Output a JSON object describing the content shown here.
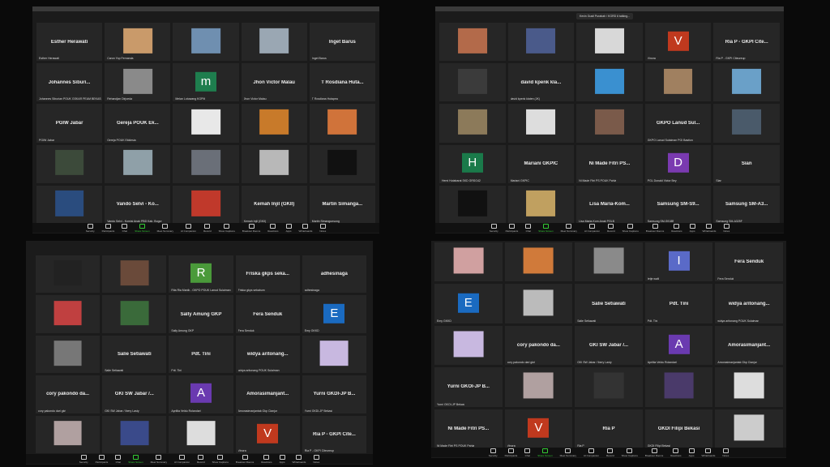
{
  "windows": [
    {
      "id": "top-left",
      "tiles": [
        {
          "type": "name",
          "label": "Esther Herawati",
          "name": "Esther Herawati"
        },
        {
          "type": "photo",
          "label": "",
          "name": "Caron Yop Fernanda",
          "color": "#c99a6a"
        },
        {
          "type": "photo",
          "label": "",
          "name": "",
          "color": "#6f8fb0"
        },
        {
          "type": "photo",
          "label": "",
          "name": "",
          "color": "#9aa7b3"
        },
        {
          "type": "name",
          "label": "Inget Barus",
          "name": "Inget Barus"
        },
        {
          "type": "name",
          "label": "Johannes Siburi...",
          "name": "Johannes Siburian POUK GSKAR PEAM BEKASI"
        },
        {
          "type": "photo",
          "label": "",
          "name": "Rehandjan Dirjoeda",
          "color": "#8a8a8a"
        },
        {
          "type": "avatar",
          "letter": "m",
          "color": "#1e7e4e",
          "name": "Melan Lotuwang KGPM"
        },
        {
          "type": "name",
          "label": "Jhon Victor Malau",
          "name": "Jhon Victor Malau"
        },
        {
          "type": "name",
          "label": "T Rosdiana Huta...",
          "name": "T Rosdiana Hutapea"
        },
        {
          "type": "name",
          "label": "PGIW Jabar",
          "name": "PGIW Jabar"
        },
        {
          "type": "name",
          "label": "Gereja POUK Ek...",
          "name": "Gereja POUK Ekklesia"
        },
        {
          "type": "photo",
          "label": "",
          "name": "",
          "color": "#e8e8e8"
        },
        {
          "type": "photo",
          "label": "",
          "name": "",
          "color": "#c87a2a"
        },
        {
          "type": "photo",
          "label": "",
          "name": "",
          "color": "#d0733a"
        },
        {
          "type": "photo",
          "label": "",
          "name": "",
          "color": "#3c4a3a"
        },
        {
          "type": "photo",
          "label": "",
          "name": "",
          "color": "#8fa0a8"
        },
        {
          "type": "photo",
          "label": "",
          "name": "",
          "color": "#6a6f78"
        },
        {
          "type": "photo",
          "label": "",
          "name": "",
          "color": "#b8b8b8"
        },
        {
          "type": "photo",
          "label": "",
          "name": "",
          "color": "#111"
        },
        {
          "type": "photo",
          "label": "",
          "name": "",
          "color": "#2a4c7e"
        },
        {
          "type": "name",
          "label": "Vando Selvi - Ko...",
          "name": "Vando Selvi - Komisi Anak PBD Kab. Bogor"
        },
        {
          "type": "photo",
          "label": "",
          "name": "",
          "color": "#c0392b"
        },
        {
          "type": "name",
          "label": "Kemah Injil (GKII)",
          "name": "Kemah Injil (GKII)"
        },
        {
          "type": "name",
          "label": "Martin Simanga...",
          "name": "Martin Simangunsong"
        }
      ]
    },
    {
      "id": "top-right",
      "banner": "Kevin Gusti Purabah / KGRD 6 talking...",
      "tiles": [
        {
          "type": "photo",
          "label": "",
          "name": "",
          "color": "#b36a4a"
        },
        {
          "type": "photo",
          "label": "",
          "name": "",
          "color": "#4a5a8a"
        },
        {
          "type": "photo",
          "label": "",
          "name": "",
          "color": "#d8d8d8"
        },
        {
          "type": "avatar",
          "letter": "V",
          "color": "#c0391e",
          "name": "Vinora"
        },
        {
          "type": "name",
          "label": "Ria P - GKPI Cite...",
          "name": "Ria P - GKPI Citeureup"
        },
        {
          "type": "photo",
          "label": "",
          "name": "",
          "color": "#3b3b3b"
        },
        {
          "type": "name",
          "label": "david kpenk kla...",
          "name": "david kpenk klaten (JK)"
        },
        {
          "type": "photo",
          "label": "",
          "name": "",
          "color": "#3a90d0"
        },
        {
          "type": "photo",
          "label": "",
          "name": "",
          "color": "#a08060"
        },
        {
          "type": "photo",
          "label": "",
          "name": "",
          "color": "#6aa0c8"
        },
        {
          "type": "photo",
          "label": "",
          "name": "",
          "color": "#8c7a5a"
        },
        {
          "type": "photo",
          "label": "",
          "name": "",
          "color": "#ddd"
        },
        {
          "type": "photo",
          "label": "",
          "name": "",
          "color": "#7a5a4a"
        },
        {
          "type": "name",
          "label": "GKPO Lanud Sul...",
          "name": "GKPO Lanud Sulaiman PGI Bastion"
        },
        {
          "type": "photo",
          "label": "",
          "name": "",
          "color": "#4a5a6a"
        },
        {
          "type": "avatar",
          "letter": "H",
          "color": "#1a7a4a",
          "name": "Hemi Hutabarat SKD GRSG42"
        },
        {
          "type": "name",
          "label": "Mariani GKPIC",
          "name": "Mariani GKPIC"
        },
        {
          "type": "name",
          "label": "Ni Made Fitri PS...",
          "name": "Ni Made Fitri PS POUK Pahla"
        },
        {
          "type": "avatar",
          "letter": "D",
          "color": "#7a3ab0",
          "name": "PGL Donald Victor Bey"
        },
        {
          "type": "name",
          "label": "Sian",
          "name": "Sian"
        },
        {
          "type": "photo",
          "label": "",
          "name": "",
          "color": "#111"
        },
        {
          "type": "photo",
          "label": "",
          "name": "",
          "color": "#c0a060"
        },
        {
          "type": "name",
          "label": "Lisa Maria-Kom...",
          "name": "Lisa Maria-Kom.Anak PGLB"
        },
        {
          "type": "name",
          "label": "Samsung SM-S9...",
          "name": "Samsung SM-S918B"
        },
        {
          "type": "name",
          "label": "Samsung SM-A3...",
          "name": "Samsung SM-A325F"
        }
      ]
    },
    {
      "id": "bottom-left",
      "tiles": [
        {
          "type": "photo",
          "label": "",
          "name": "",
          "color": "#222"
        },
        {
          "type": "photo",
          "label": "",
          "name": "",
          "color": "#6a4a3a"
        },
        {
          "type": "avatar",
          "letter": "R",
          "color": "#4a9a3a",
          "name": "Rita Ria Manik - GKPO POUK Lanud Sulaiman"
        },
        {
          "type": "name",
          "label": "Friska gkps seka...",
          "name": "Friska gkps sekabum"
        },
        {
          "type": "name",
          "label": "adhesinaga",
          "name": "adhesinaga"
        },
        {
          "type": "photo",
          "label": "",
          "name": "",
          "color": "#c04040"
        },
        {
          "type": "photo",
          "label": "",
          "name": "",
          "color": "#3a6a3a"
        },
        {
          "type": "name",
          "label": "Sally Amung GKP",
          "name": "Sally Amung GKP"
        },
        {
          "type": "name",
          "label": "Fera Senduk",
          "name": "Fera Senduk"
        },
        {
          "type": "avatar",
          "letter": "E",
          "color": "#1a6ac0",
          "name": "Emy GKKD"
        },
        {
          "type": "photo",
          "label": "",
          "name": "",
          "color": "#777"
        },
        {
          "type": "name",
          "label": "Salie Setiawati",
          "name": "Salie Setiawati"
        },
        {
          "type": "name",
          "label": "Pdt. Tini",
          "name": "Pdt. Tini"
        },
        {
          "type": "name",
          "label": "widya aritonang...",
          "name": "widya aritonang POUK Sulaiman"
        },
        {
          "type": "photo",
          "label": "",
          "name": "",
          "color": "#c8b8e0"
        },
        {
          "type": "name",
          "label": "cory pakondo da...",
          "name": "cory pakondo dari gkri"
        },
        {
          "type": "name",
          "label": "GKI SW Jabar /...",
          "name": "GKI SW Jabar / Ibery Lasty"
        },
        {
          "type": "avatar",
          "letter": "A",
          "color": "#6a3ab0",
          "name": "Apriliia Veldu Rolandari"
        },
        {
          "type": "name",
          "label": "Amorasimanjant...",
          "name": "Amorasimanjantak Gkp Cianjur"
        },
        {
          "type": "name",
          "label": "Yurni GKDI-JP B...",
          "name": "Yurni GKDI-JP Bekasi"
        },
        {
          "type": "photo",
          "label": "",
          "name": "",
          "color": "#b0a0a0"
        },
        {
          "type": "photo",
          "label": "",
          "name": "",
          "color": "#3a4a8a"
        },
        {
          "type": "photo",
          "label": "",
          "name": "",
          "color": "#ddd"
        },
        {
          "type": "avatar",
          "letter": "V",
          "color": "#c0391e",
          "name": "Vinora"
        },
        {
          "type": "name",
          "label": "Ria P - GKPI Cite...",
          "name": "Ria P - GKPI Citeureup"
        }
      ]
    },
    {
      "id": "bottom-right",
      "tiles": [
        {
          "type": "photo",
          "label": "",
          "name": "",
          "color": "#d0a0a0"
        },
        {
          "type": "photo",
          "label": "",
          "name": "",
          "color": "#d07a3a"
        },
        {
          "type": "photo",
          "label": "",
          "name": "",
          "color": "#8a8a8a"
        },
        {
          "type": "avatar",
          "letter": "I",
          "color": "#5a6ac8",
          "name": "Ietje walti"
        },
        {
          "type": "name",
          "label": "Fera Senduk",
          "name": "Fera Senduk"
        },
        {
          "type": "avatar",
          "letter": "E",
          "color": "#1a6ac0",
          "name": "Emy GKKD"
        },
        {
          "type": "photo",
          "label": "",
          "name": "",
          "color": "#bbb"
        },
        {
          "type": "name",
          "label": "Salie Setiawati",
          "name": "Salie Setiawati"
        },
        {
          "type": "name",
          "label": "Pdt. Tini",
          "name": "Pdt. Tini"
        },
        {
          "type": "name",
          "label": "widya aritonang...",
          "name": "widya aritonang POUK Sulaiman"
        },
        {
          "type": "photo",
          "label": "",
          "name": "",
          "color": "#c8b8e0"
        },
        {
          "type": "name",
          "label": "cory pakondo da...",
          "name": "cory pakondo dari gkri"
        },
        {
          "type": "name",
          "label": "GKI SW Jabar /...",
          "name": "GKI SW Jabar / Ibery Lasty"
        },
        {
          "type": "avatar",
          "letter": "A",
          "color": "#6a3ab0",
          "name": "Apriliia Veldu Rolandari"
        },
        {
          "type": "name",
          "label": "Amorasimanjant...",
          "name": "Amorasimanjantak Gkp Cianjur"
        },
        {
          "type": "name",
          "label": "Yurni GKOI-JP B...",
          "name": "Yurni GKOI-JP Bekasi"
        },
        {
          "type": "photo",
          "label": "",
          "name": "",
          "color": "#b0a0a0"
        },
        {
          "type": "photo",
          "label": "",
          "name": "",
          "color": "#333"
        },
        {
          "type": "photo",
          "label": "",
          "name": "",
          "color": "#4a3a6a"
        },
        {
          "type": "photo",
          "label": "",
          "name": "",
          "color": "#ddd"
        },
        {
          "type": "name",
          "label": "Ni Made Fitri PS...",
          "name": "Ni Made Fitri PS POUK Pahla"
        },
        {
          "type": "avatar",
          "letter": "V",
          "color": "#c0391e",
          "name": "Vinora"
        },
        {
          "type": "name",
          "label": "Ria P",
          "name": "Ria P"
        },
        {
          "type": "name",
          "label": "GKDI Filipi Bekasi",
          "name": "GKDI Filipi Bekasi"
        },
        {
          "type": "photo",
          "label": "",
          "name": "",
          "color": "#ccc"
        }
      ]
    }
  ],
  "toolbar": [
    {
      "label": "Security",
      "icon": "shield-icon"
    },
    {
      "label": "Participants",
      "icon": "participants-icon"
    },
    {
      "label": "Chat",
      "icon": "chat-icon"
    },
    {
      "label": "Share Screen",
      "icon": "share-screen-icon",
      "accent": "#33cc33"
    },
    {
      "label": "Meet Summary",
      "icon": "summary-icon"
    },
    {
      "label": "AI Companion",
      "icon": "ai-companion-icon"
    },
    {
      "label": "Record",
      "icon": "record-icon"
    },
    {
      "label": "Show Captions",
      "icon": "captions-icon"
    },
    {
      "label": "Breakout Rooms",
      "icon": "breakout-icon"
    },
    {
      "label": "Reactions",
      "icon": "reactions-icon"
    },
    {
      "label": "Apps",
      "icon": "apps-icon"
    },
    {
      "label": "Whiteboards",
      "icon": "whiteboard-icon"
    },
    {
      "label": "Notes",
      "icon": "notes-icon"
    }
  ]
}
